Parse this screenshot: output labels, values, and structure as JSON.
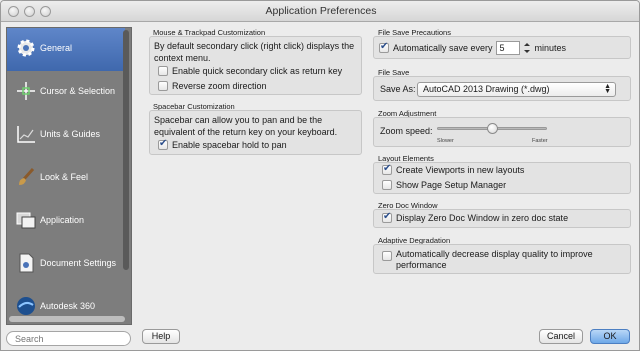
{
  "window": {
    "title": "Application Preferences"
  },
  "sidebar": {
    "items": [
      {
        "label": "General",
        "icon": "gear-icon",
        "selected": true
      },
      {
        "label": "Cursor & Selection",
        "icon": "crosshair-icon",
        "selected": false
      },
      {
        "label": "Units & Guides",
        "icon": "ruler-chart-icon",
        "selected": false
      },
      {
        "label": "Look & Feel",
        "icon": "paintbrush-icon",
        "selected": false
      },
      {
        "label": "Application",
        "icon": "windows-icon",
        "selected": false
      },
      {
        "label": "Document Settings",
        "icon": "document-icon",
        "selected": false
      },
      {
        "label": "Autodesk 360",
        "icon": "autodesk-360-icon",
        "selected": false
      }
    ]
  },
  "search": {
    "placeholder": "Search"
  },
  "mouse": {
    "title": "Mouse & Trackpad Customization",
    "description": "By default secondary click (right click) displays the context menu.",
    "options": [
      {
        "label": "Enable quick secondary click as return key",
        "checked": false
      },
      {
        "label": "Reverse zoom direction",
        "checked": false
      }
    ]
  },
  "spacebar": {
    "title": "Spacebar Customization",
    "description": "Spacebar can allow you to pan and be the equivalent of the return key on your keyboard.",
    "option": {
      "label": "Enable spacebar hold to pan",
      "checked": true
    }
  },
  "file_save_precautions": {
    "title": "File Save Precautions",
    "label": "Automatically save every",
    "value": "5",
    "unit": "minutes",
    "checked": true
  },
  "file_save": {
    "title": "File Save",
    "label": "Save As:",
    "selected": "AutoCAD 2013 Drawing (*.dwg)"
  },
  "zoom": {
    "title": "Zoom Adjustment",
    "label": "Zoom speed:",
    "min_label": "Slower",
    "max_label": "Faster",
    "value_fraction": 0.5
  },
  "layout_elements": {
    "title": "Layout Elements",
    "options": [
      {
        "label": "Create Viewports in new layouts",
        "checked": true
      },
      {
        "label": "Show Page Setup Manager",
        "checked": false
      }
    ]
  },
  "zero_doc": {
    "title": "Zero Doc Window",
    "option": {
      "label": "Display Zero Doc Window in zero doc state",
      "checked": true
    }
  },
  "adaptive": {
    "title": "Adaptive Degradation",
    "option": {
      "label": "Automatically decrease display quality to improve performance",
      "checked": false
    }
  },
  "buttons": {
    "help": "Help",
    "cancel": "Cancel",
    "ok": "OK"
  },
  "colors": {
    "accent": "#4a73b8",
    "sidebar": "#7d7d7d"
  }
}
